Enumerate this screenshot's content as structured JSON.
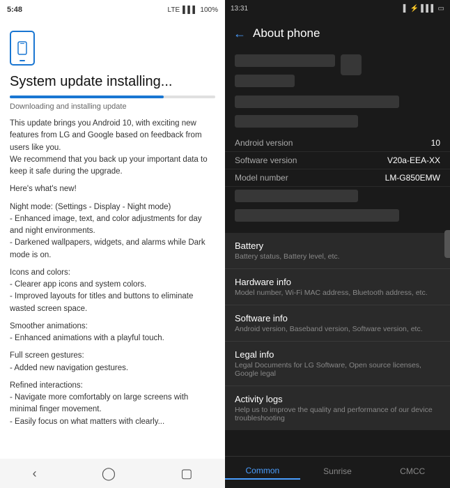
{
  "left": {
    "statusBar": {
      "time": "5:48",
      "lte": "LTE",
      "battery": "100%"
    },
    "title": "System update installing...",
    "progressPercent": 75,
    "downloadingLabel": "Downloading and installing update",
    "body": [
      "This update brings you Android 10, with exciting new features from LG and Google based on feedback from users like you.",
      "We recommend that you back up your important data to keep it safe during the upgrade.",
      "Here's what's new!",
      "Night mode: (Settings - Display - Night mode)\n- Enhanced image, text, and color adjustments for day and night environments.\n- Darkened wallpapers, widgets, and alarms while Dark mode is on.",
      "Icons and colors:\n- Clearer app icons and system colors.\n- Improved layouts for titles and buttons to eliminate wasted screen space.",
      "Smoother animations:\n- Enhanced animations with a playful touch.",
      "Full screen gestures:\n- Added new navigation gestures.",
      "Refined interactions:\n- Navigate more comfortably on large screens with minimal finger movement.\n- Easily focus on what matters with clearly..."
    ],
    "nav": {
      "back": "‹",
      "home": "⬤",
      "recent": "▢"
    }
  },
  "right": {
    "statusBar": {
      "time": "13:31"
    },
    "header": {
      "backLabel": "←",
      "title": "About phone"
    },
    "deviceInfo": {
      "androidVersionLabel": "Android version",
      "androidVersionValue": "10",
      "softwareVersionLabel": "Software version",
      "softwareVersionValue": "V20a-EEA-XX",
      "modelNumberLabel": "Model number",
      "modelNumberValue": "LM-G850EMW"
    },
    "menuItems": [
      {
        "title": "Battery",
        "desc": "Battery status, Battery level, etc."
      },
      {
        "title": "Hardware info",
        "desc": "Model number, Wi-Fi MAC address, Bluetooth address, etc."
      },
      {
        "title": "Software info",
        "desc": "Android version, Baseband version, Software version, etc."
      },
      {
        "title": "Legal info",
        "desc": "Legal Documents for LG Software, Open source licenses, Google legal"
      },
      {
        "title": "Activity logs",
        "desc": "Help us to improve the quality and performance of our device troubleshooting"
      }
    ],
    "tabs": [
      {
        "label": "Common",
        "active": true
      },
      {
        "label": "Sunrise",
        "active": false
      },
      {
        "label": "CMCC",
        "active": false
      }
    ]
  }
}
